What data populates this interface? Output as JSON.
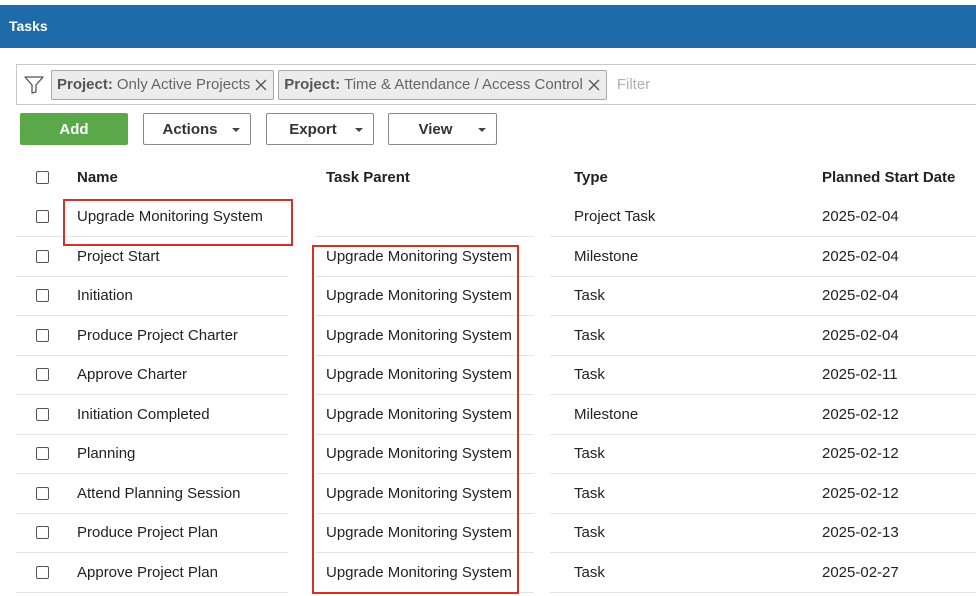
{
  "window": {
    "title": "Tasks"
  },
  "filters": {
    "chips": [
      {
        "key": "Project:",
        "value": "Only Active Projects"
      },
      {
        "key": "Project:",
        "value": "Time & Attendance / Access Control"
      }
    ],
    "placeholder": "Filter"
  },
  "toolbar": {
    "add_label": "Add",
    "actions_label": "Actions",
    "export_label": "Export",
    "view_label": "View"
  },
  "table": {
    "columns": {
      "name": "Name",
      "parent": "Task Parent",
      "type": "Type",
      "start": "Planned Start Date"
    },
    "rows": [
      {
        "name": "Upgrade Monitoring System",
        "parent": "",
        "type": "Project Task",
        "start": "2025-02-04"
      },
      {
        "name": "Project Start",
        "parent": "Upgrade Monitoring System",
        "type": "Milestone",
        "start": "2025-02-04"
      },
      {
        "name": "Initiation",
        "parent": "Upgrade Monitoring System",
        "type": "Task",
        "start": "2025-02-04"
      },
      {
        "name": "Produce Project Charter",
        "parent": "Upgrade Monitoring System",
        "type": "Task",
        "start": "2025-02-04"
      },
      {
        "name": "Approve Charter",
        "parent": "Upgrade Monitoring System",
        "type": "Task",
        "start": "2025-02-11"
      },
      {
        "name": "Initiation Completed",
        "parent": "Upgrade Monitoring System",
        "type": "Milestone",
        "start": "2025-02-12"
      },
      {
        "name": "Planning",
        "parent": "Upgrade Monitoring System",
        "type": "Task",
        "start": "2025-02-12"
      },
      {
        "name": "Attend Planning Session",
        "parent": "Upgrade Monitoring System",
        "type": "Task",
        "start": "2025-02-12"
      },
      {
        "name": "Produce Project Plan",
        "parent": "Upgrade Monitoring System",
        "type": "Task",
        "start": "2025-02-13"
      },
      {
        "name": "Approve Project Plan",
        "parent": "Upgrade Monitoring System",
        "type": "Task",
        "start": "2025-02-27"
      }
    ]
  },
  "colors": {
    "titlebar": "#1f6aa9",
    "add_button": "#5aa84a",
    "highlight": "#d93025"
  }
}
